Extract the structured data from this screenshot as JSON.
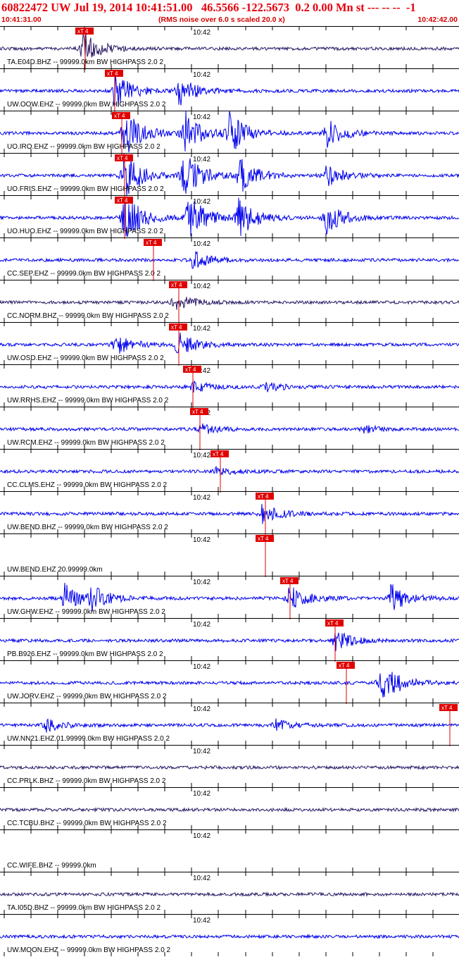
{
  "header": {
    "title": "60822472 UW Jul 19, 2014 10:41:51.00   46.5566 -122.5673  0.2 0.00 Mn st --- -- --  -1",
    "time_start": "10:41:31.00",
    "time_end": "10:42:42.00",
    "note": "(RMS noise over 6.0 s scaled 20.0 x)",
    "minute_label": "10:42"
  },
  "pick_marker_text": "xT 4",
  "colors": {
    "header_text": "#e8000d",
    "pick": "#e00000",
    "trace_blue": "#0000ee",
    "trace_dark": "#2a1a66",
    "grid": "#000000"
  },
  "traces": [
    {
      "label": "TA.E04D.BHZ -- 99999.0km BW  HIGHPASS  2.0  2",
      "color": "dark",
      "pick": 0.185,
      "bursts": [
        [
          0.18,
          0.9
        ]
      ]
    },
    {
      "label": "UW.OOW.EHZ -- 99999.0km BW  HIGHPASS  2.0  2",
      "color": "blue",
      "pick": 0.25,
      "bursts": [
        [
          0.25,
          1.0
        ],
        [
          0.39,
          0.8
        ]
      ]
    },
    {
      "label": "UO.IRO.EHZ -- 99999.0km BW  HIGHPASS  2.0  2",
      "color": "blue",
      "pick": 0.265,
      "bursts": [
        [
          0.27,
          1.3
        ],
        [
          0.4,
          1.3
        ],
        [
          0.5,
          1.1
        ],
        [
          0.71,
          0.8
        ]
      ]
    },
    {
      "label": "UO.FRIS.EHZ -- 99999.0km BW  HIGHPASS  2.0  2",
      "color": "blue",
      "pick": 0.272,
      "bursts": [
        [
          0.27,
          1.4
        ],
        [
          0.4,
          1.3
        ],
        [
          0.52,
          1.0
        ],
        [
          0.71,
          0.6
        ]
      ]
    },
    {
      "label": "UO.HUO.EHZ -- 99999.0km BW  HIGHPASS  2.0  2",
      "color": "blue",
      "pick": 0.272,
      "bursts": [
        [
          0.27,
          1.4
        ],
        [
          0.41,
          1.3
        ],
        [
          0.52,
          1.0
        ],
        [
          0.71,
          0.9
        ]
      ]
    },
    {
      "label": "CC.SEP.EHZ -- 99999.0km BW  HIGHPASS  2.0  2",
      "color": "blue",
      "pick": 0.335,
      "bursts": [
        [
          0.42,
          0.5
        ]
      ]
    },
    {
      "label": "CC.NORM.BHZ -- 99999.0km BW  HIGHPASS  2.0  2",
      "color": "dark",
      "pick": 0.39,
      "bursts": [
        [
          0.38,
          0.5
        ]
      ]
    },
    {
      "label": "UW.OSD.EHZ -- 99999.0km BW  HIGHPASS  2.0  2",
      "color": "blue",
      "pick": 0.39,
      "bursts": [
        [
          0.25,
          0.6
        ],
        [
          0.385,
          0.7
        ]
      ]
    },
    {
      "label": "UW.RRHS.EHZ -- 99999.0km BW  HIGHPASS  2.0  2",
      "color": "blue",
      "pick": 0.42,
      "bursts": [
        [
          0.42,
          0.3
        ],
        [
          0.58,
          0.25
        ]
      ]
    },
    {
      "label": "UW.RCM.EHZ -- 99999.0km BW  HIGHPASS  2.0  2",
      "color": "blue",
      "pick": 0.435,
      "bursts": [
        [
          0.435,
          0.3
        ],
        [
          0.79,
          0.2
        ]
      ]
    },
    {
      "label": "CC.CLMS.EHZ -- 99999.0km BW  HIGHPASS  2.0  2",
      "color": "blue",
      "pick": 0.48,
      "bursts": [
        [
          0.47,
          0.2
        ]
      ]
    },
    {
      "label": "UW.BEND.BHZ -- 99999.0km BW  HIGHPASS  2.0  2",
      "color": "blue",
      "pick": 0.578,
      "bursts": [
        [
          0.57,
          0.55
        ]
      ]
    },
    {
      "label": "UW.BEND.EHZ 20.99999.0km",
      "color": "none",
      "pick": 0.578,
      "bursts": []
    },
    {
      "label": "UW.GHW.EHZ -- 99999.0km BW  HIGHPASS  2.0  2",
      "color": "blue",
      "pick": 0.632,
      "bursts": [
        [
          0.14,
          0.8
        ],
        [
          0.2,
          0.6
        ],
        [
          0.63,
          0.7
        ],
        [
          0.85,
          0.8
        ]
      ]
    },
    {
      "label": "PB.B926.EHZ -- 99999.0km BW  HIGHPASS  2.0  2",
      "color": "blue",
      "pick": 0.73,
      "bursts": [
        [
          0.73,
          0.6
        ]
      ]
    },
    {
      "label": "UW.JORV.EHZ -- 99999.0km BW  HIGHPASS  2.0  2",
      "color": "blue",
      "pick": 0.755,
      "bursts": [
        [
          0.83,
          1.2
        ]
      ]
    },
    {
      "label": "UW.NN21.EHZ.01.99999.0km BW  HIGHPASS  2.0  2",
      "color": "blue",
      "pick": 0.98,
      "bursts": [
        [
          0.1,
          0.35
        ],
        [
          0.6,
          0.3
        ]
      ]
    },
    {
      "label": "CC.PRLK.BHZ -- 99999.0km BW  HIGHPASS  2.0  2",
      "color": "dark",
      "pick": null,
      "bursts": []
    },
    {
      "label": "CC.TCBU.BHZ -- 99999.0km BW  HIGHPASS  2.0  2",
      "color": "dark",
      "pick": null,
      "bursts": []
    },
    {
      "label": "CC.WIFE.BHZ -- 99999.0km",
      "color": "none",
      "pick": null,
      "bursts": []
    },
    {
      "label": "TA.I05D.BHZ -- 99999.0km BW  HIGHPASS  2.0  2",
      "color": "dark",
      "pick": null,
      "bursts": []
    },
    {
      "label": "UW.MOON.EHZ -- 99999.0km BW  HIGHPASS  2.0  2",
      "color": "blue",
      "pick": null,
      "bursts": []
    }
  ]
}
